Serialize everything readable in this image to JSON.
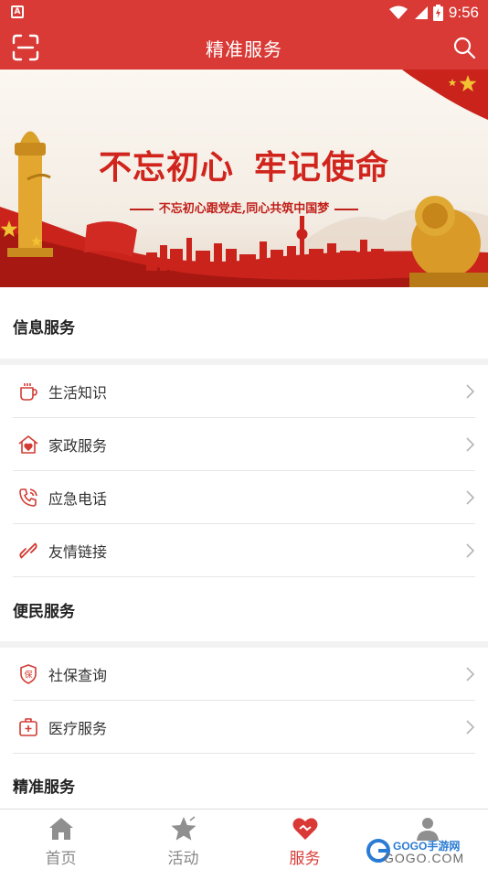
{
  "status_bar": {
    "time": "9:56",
    "left_icon_letter": "A"
  },
  "app_bar": {
    "title": "精准服务"
  },
  "banner": {
    "title_part1": "不忘初心",
    "title_part2": "牢记使命",
    "subtitle": "不忘初心跟党走,同心共筑中国梦"
  },
  "sections": [
    {
      "title": "信息服务",
      "items": [
        {
          "label": "生活知识",
          "icon": "cup-icon"
        },
        {
          "label": "家政服务",
          "icon": "home-heart-icon"
        },
        {
          "label": "应急电话",
          "icon": "phone-icon"
        },
        {
          "label": "友情链接",
          "icon": "link-icon"
        }
      ]
    },
    {
      "title": "便民服务",
      "items": [
        {
          "label": "社保查询",
          "icon": "shield-icon"
        },
        {
          "label": "医疗服务",
          "icon": "medical-kit-icon"
        }
      ]
    },
    {
      "title": "精准服务",
      "items": []
    }
  ],
  "bottom_nav": [
    {
      "label": "首页",
      "icon": "home-icon",
      "active": false
    },
    {
      "label": "活动",
      "icon": "star-icon",
      "active": false
    },
    {
      "label": "服务",
      "icon": "heart-icon",
      "active": true
    },
    {
      "label": "",
      "icon": "person-icon",
      "active": false
    }
  ],
  "watermark": {
    "text": "GOGO手游网",
    "sub": "GOGO.COM"
  },
  "colors": {
    "accent": "#d93a36",
    "text": "#333333",
    "muted": "#888888"
  }
}
